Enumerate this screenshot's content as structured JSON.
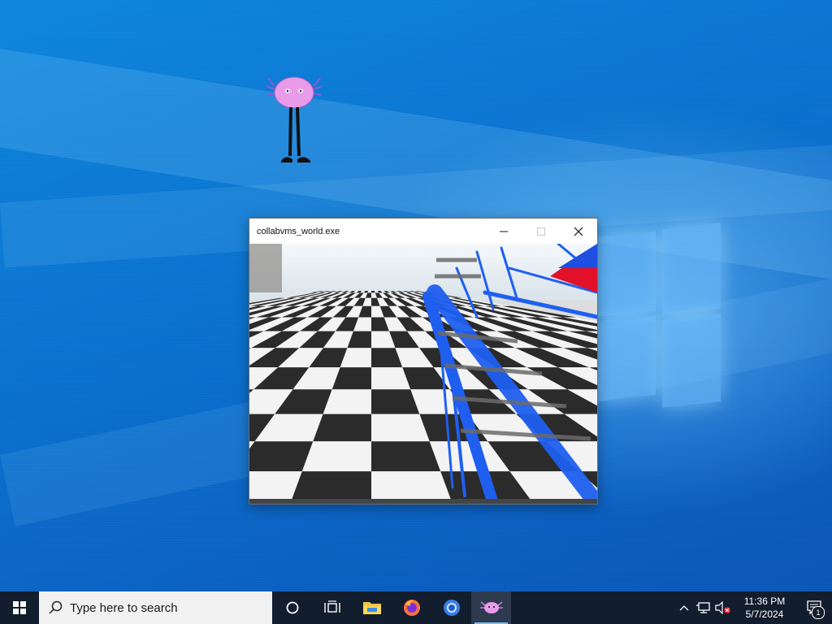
{
  "desktop": {
    "mascot_icon": "axolotl-icon"
  },
  "window": {
    "title": "collabvms_world.exe",
    "controls": [
      "minimize-icon",
      "maximize-icon",
      "close-icon"
    ],
    "content": "3d-checkerboard-scene"
  },
  "taskbar": {
    "start_icon": "windows-start-icon",
    "search_placeholder": "Type here to search",
    "pinned": [
      {
        "name": "cortana-icon"
      },
      {
        "name": "task-view-icon"
      },
      {
        "name": "file-explorer-icon"
      },
      {
        "name": "firefox-icon"
      },
      {
        "name": "chrome-icon"
      },
      {
        "name": "axolotl-app-icon",
        "active": true
      }
    ],
    "tray": {
      "chevron_icon": "chevron-up-icon",
      "network_icon": "network-icon",
      "volume_icon": "volume-muted-icon",
      "time": "11:36 PM",
      "date": "5/7/2024",
      "notifications_count": "1"
    }
  },
  "colors": {
    "taskbar_bg": "#121d2e",
    "desktop_blue": "#0a78d4",
    "accent": "#76b9ed"
  }
}
